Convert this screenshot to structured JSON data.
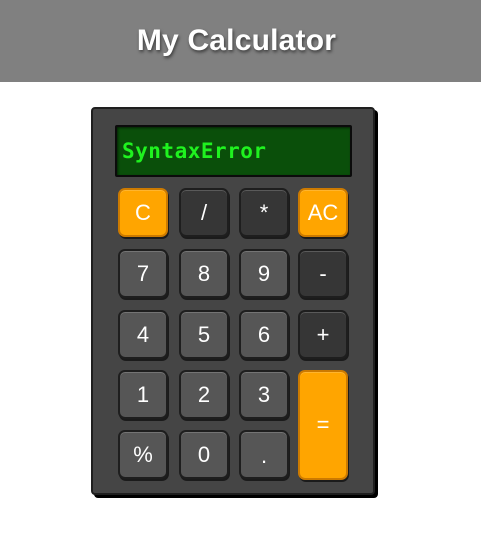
{
  "header": {
    "title": "My Calculator"
  },
  "display": {
    "value": "SyntaxError"
  },
  "keys": {
    "clear": "C",
    "divide": "/",
    "multiply": "*",
    "all_clear": "AC",
    "seven": "7",
    "eight": "8",
    "nine": "9",
    "minus": "-",
    "four": "4",
    "five": "5",
    "six": "6",
    "plus": "+",
    "one": "1",
    "two": "2",
    "three": "3",
    "equals": "=",
    "percent": "%",
    "zero": "0",
    "decimal": "."
  },
  "colors": {
    "header_bg": "#808080",
    "body_bg": "#454545",
    "accent": "#ffa500",
    "display_bg": "#0a4f0a",
    "display_text": "#1ff21f",
    "number_key": "#565656",
    "operator_key": "#363636"
  }
}
